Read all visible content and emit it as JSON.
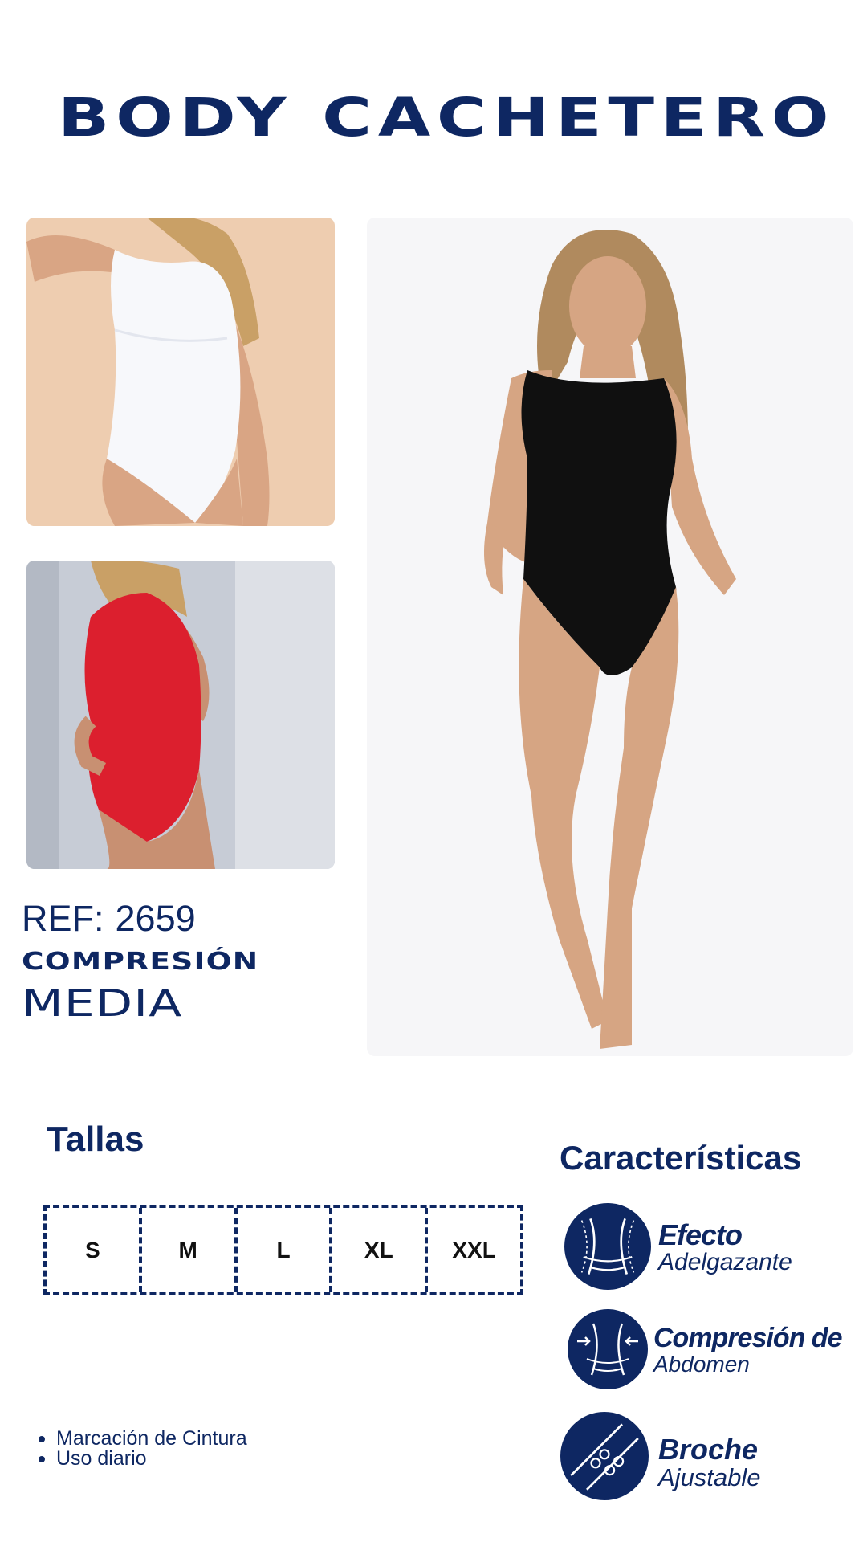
{
  "title": "BODY CACHETERO",
  "photos": {
    "white": "white-bodysuit-photo",
    "red": "red-bodysuit-photo",
    "black": "black-bodysuit-photo"
  },
  "ref": {
    "label": "REF:",
    "number": "2659"
  },
  "compression": {
    "line1": "COMPRESIÓN",
    "line2": "MEDIA"
  },
  "sizes": {
    "title": "Tallas",
    "items": [
      "S",
      "M",
      "L",
      "XL",
      "XXL"
    ]
  },
  "bullets": [
    "Marcación de Cintura",
    "Uso diario"
  ],
  "features": {
    "title": "Características",
    "items": [
      {
        "icon": "waist-slimming-icon",
        "line1": "Efecto",
        "line2": "Adelgazante"
      },
      {
        "icon": "abdomen-compression-icon",
        "line1": "Compresión de",
        "line2": "Abdomen"
      },
      {
        "icon": "adjustable-hook-icon",
        "line1": "Broche",
        "line2": "Ajustable"
      }
    ]
  },
  "colors": {
    "brand_navy": "#0e2762",
    "background": "#ffffff"
  }
}
